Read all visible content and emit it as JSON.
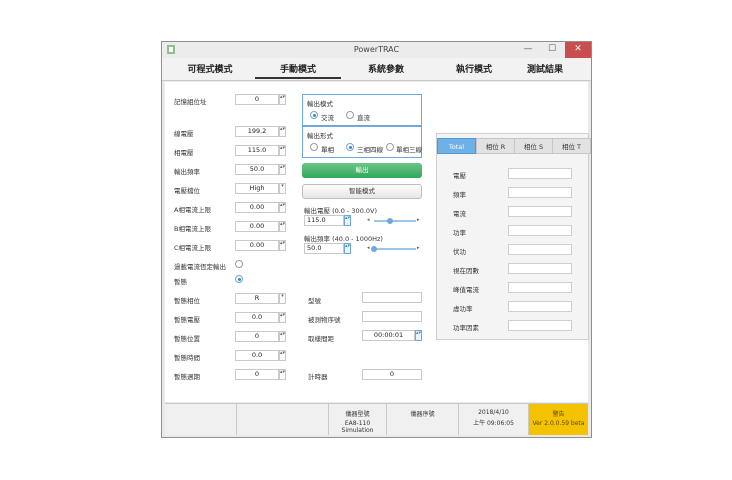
{
  "window": {
    "title": "PowerTRAC",
    "minimize": "—",
    "maximize": "☐",
    "close": "✕"
  },
  "menu": [
    "可程式模式",
    "手動模式",
    "系統參數",
    "執行模式",
    "測試結果"
  ],
  "memory": {
    "label": "記憶組位址",
    "value": "0"
  },
  "left_fields": [
    {
      "label": "線電壓",
      "value": "199.2"
    },
    {
      "label": "相電壓",
      "value": "115.0"
    },
    {
      "label": "輸出頻率",
      "value": "50.0"
    },
    {
      "label": "電壓檔位",
      "value": "High"
    },
    {
      "label": "A相電流上限",
      "value": "0.00"
    },
    {
      "label": "B相電流上限",
      "value": "0.00"
    },
    {
      "label": "C相電流上限",
      "value": "0.00"
    }
  ],
  "overcurrent_label": "過載電流恆定輸出",
  "surge_label": "暫態",
  "surge_fields": [
    {
      "label": "暫態相位",
      "value": "R"
    },
    {
      "label": "暫態電壓",
      "value": "0.0"
    },
    {
      "label": "暫態位置",
      "value": "0"
    },
    {
      "label": "暫態時間",
      "value": "0.0"
    },
    {
      "label": "暫態週期",
      "value": "0"
    }
  ],
  "output_mode": {
    "label": "輸出模式",
    "options": [
      "交流",
      "直流"
    ],
    "selected": 0
  },
  "output_type": {
    "label": "輸出形式",
    "options": [
      "單相",
      "三相四線",
      "單相三線"
    ],
    "selected": 1
  },
  "output_button": "輸出",
  "mode_button": "智能模式",
  "voltage_ctrl": {
    "label": "輸出電壓 (0.0 - 300.0V)",
    "value": "115.0",
    "level": 0.38
  },
  "freq_ctrl": {
    "label": "輸出頻率 (40.0 - 1000Hz)",
    "value": "50.0",
    "level": 0.01
  },
  "info_fields": [
    {
      "label": "型號",
      "value": ""
    },
    {
      "label": "被測物序號",
      "value": ""
    },
    {
      "label": "取樣間距",
      "value": "00:00:01"
    }
  ],
  "counter": {
    "label": "計時器",
    "value": "0"
  },
  "tabs": [
    "Total",
    "相位 R",
    "相位 S",
    "相位 T"
  ],
  "measurements": [
    "電壓",
    "頻率",
    "電流",
    "功率",
    "伏功",
    "視在因數",
    "峰值電流",
    "虛功率",
    "功率因素"
  ],
  "status": {
    "model_label": "儀器型號",
    "model_value": "EA8-110 Simulation",
    "serial_label": "儀器序號",
    "date": "2018/4/10",
    "time": "上午 09:06:05",
    "warn": "警告",
    "version": "Ver 2.0.0.59 beta"
  },
  "colors": {
    "accent": "#6fa8dc",
    "green": "#2fa85a",
    "warning": "#f5c200",
    "close": "#c94f4f"
  }
}
